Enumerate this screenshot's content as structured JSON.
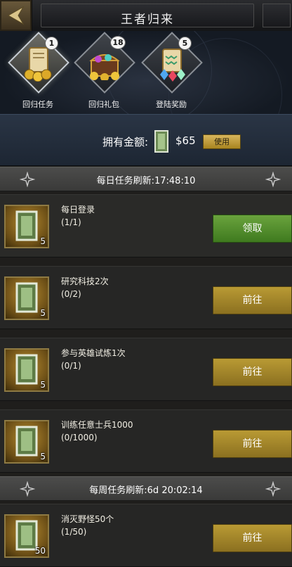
{
  "header": {
    "title": "王者归来"
  },
  "tabs": [
    {
      "label": "回归任务",
      "badge": "1",
      "icon": "scroll-coins-icon"
    },
    {
      "label": "回归礼包",
      "badge": "18",
      "icon": "treasure-chest-icon"
    },
    {
      "label": "登陆奖励",
      "badge": "5",
      "icon": "gems-scroll-icon"
    }
  ],
  "balance": {
    "label": "拥有金额:",
    "value": "$65",
    "use_label": "使用"
  },
  "daily": {
    "header": "每日任务刷新:17:48:10",
    "tasks": [
      {
        "title": "每日登录",
        "progress": "(1/1)",
        "qty": "5",
        "button": "领取"
      },
      {
        "title": "研究科技2次",
        "progress": "(0/2)",
        "qty": "5",
        "button": "前往"
      },
      {
        "title": "参与英雄试炼1次",
        "progress": "(0/1)",
        "qty": "5",
        "button": "前往"
      },
      {
        "title": "训练任意士兵1000",
        "progress": "(0/1000)",
        "qty": "5",
        "button": "前往"
      }
    ]
  },
  "weekly": {
    "header": "每周任务刷新:6d 20:02:14",
    "tasks": [
      {
        "title": "消灭野怪50个",
        "progress": "(1/50)",
        "qty": "50",
        "button": "前往"
      }
    ]
  },
  "colors": {
    "claim": "#5a9331",
    "go": "#a7882b",
    "gold_border": "#8e7a43"
  }
}
